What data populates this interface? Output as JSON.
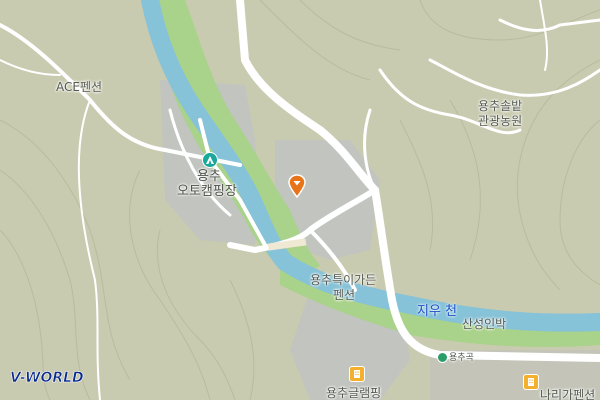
{
  "map": {
    "provider_logo": "V-WORLD",
    "colors": {
      "terrain": "#c9cbb0",
      "facility_area": "#c2c4bf",
      "river": "#86c2d8",
      "riverbank": "#a9d28a",
      "road": "#ffffff",
      "contour": "#b8bb9e",
      "label": "#555b52",
      "river_label": "#1e4fc4",
      "marker": "#e8741a"
    },
    "labels": {
      "ace_pension": "ACE펜션",
      "songbat_line1": "용추솔밭",
      "songbat_line2": "관광농원",
      "camp_line1": "용추",
      "camp_line2": "오토캠핑장",
      "tukyi_line1": "용추특이가든",
      "tukyi_line2": "펜션",
      "jiu_stream": "지우 천",
      "sanseong": "산성인박",
      "glamping": "용추글램핑",
      "small_bottom": "용추곡",
      "nari_pension": "나리가펜션"
    },
    "icons": {
      "camp": "campground-icon",
      "marker": "location-pin-icon",
      "lodging": "lodging-icon"
    }
  }
}
